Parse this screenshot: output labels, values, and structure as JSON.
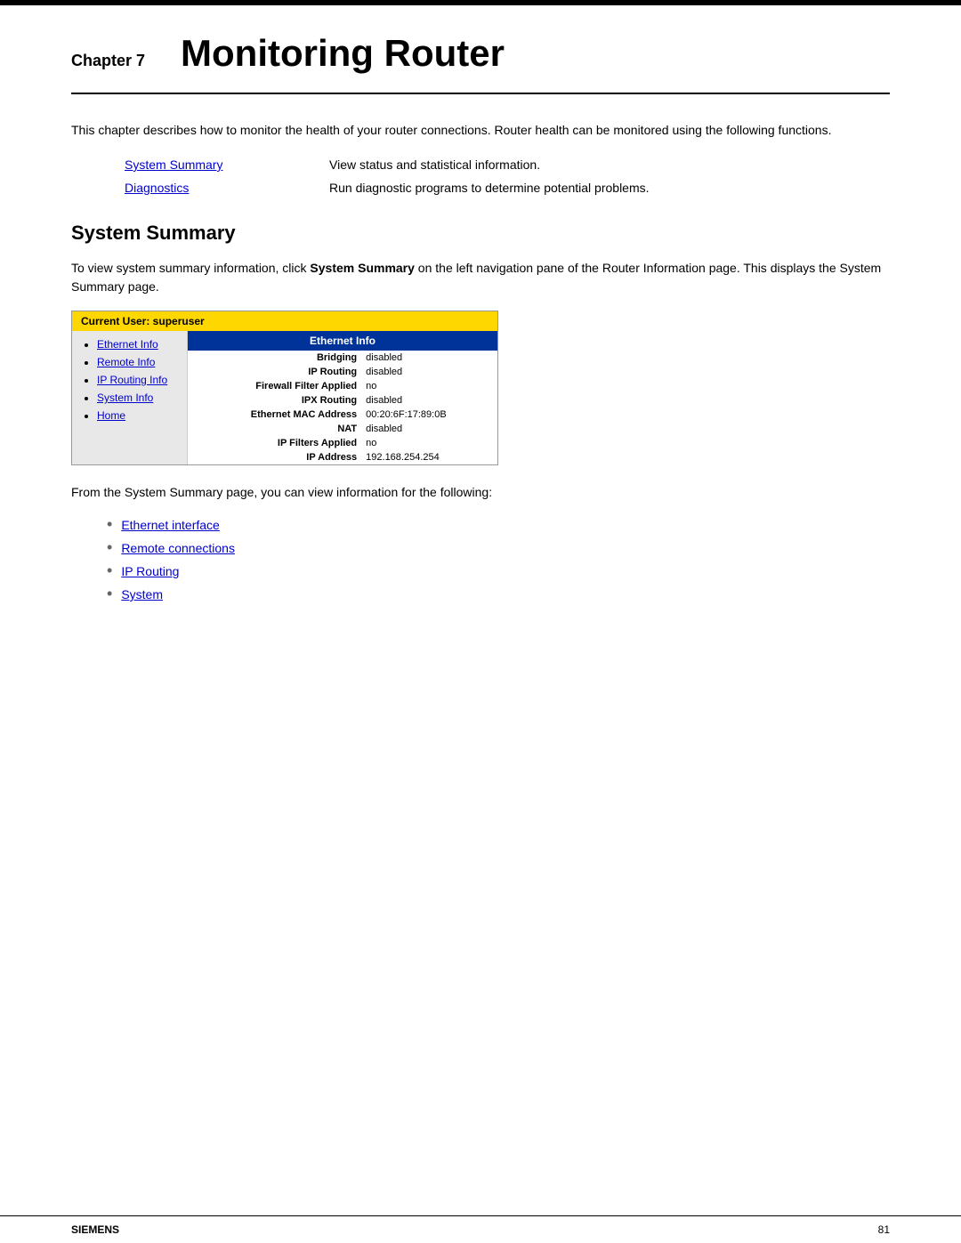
{
  "header": {
    "top_label": "Chapter 7",
    "title": "Monitoring Router"
  },
  "intro": {
    "paragraph": "This chapter describes how to monitor the health of your router connections. Router health can be monitored using the following functions."
  },
  "functions": [
    {
      "link_text": "System Summary",
      "description": "View status and statistical information."
    },
    {
      "link_text": "Diagnostics",
      "description": "Run diagnostic programs to determine potential problems."
    }
  ],
  "system_summary": {
    "heading": "System Summary",
    "intro": "To view system summary information, click System Summary on the left navigation pane of the Router Information page. This displays the System Summary page.",
    "router_ui": {
      "header_text": "Current User: superuser",
      "nav_links": [
        "Ethernet Info",
        "Remote Info",
        "IP Routing Info",
        "System Info",
        "Home"
      ],
      "content_panel_title": "Ethernet Info",
      "content_rows": [
        {
          "label": "Bridging",
          "value": "disabled"
        },
        {
          "label": "IP Routing",
          "value": "disabled"
        },
        {
          "label": "Firewall Filter Applied",
          "value": "no"
        },
        {
          "label": "IPX Routing",
          "value": "disabled"
        },
        {
          "label": "Ethernet MAC Address",
          "value": "00:20:6F:17:89:0B"
        },
        {
          "label": "NAT",
          "value": "disabled"
        },
        {
          "label": "IP Filters Applied",
          "value": "no"
        },
        {
          "label": "IP Address",
          "value": "192.168.254.254"
        }
      ]
    },
    "from_text": "From the System Summary page, you can view information for the following:",
    "bullet_links": [
      "Ethernet interface",
      "Remote connections",
      "IP Routing",
      "System"
    ]
  },
  "footer": {
    "brand": "SIEMENS",
    "page_number": "81"
  }
}
